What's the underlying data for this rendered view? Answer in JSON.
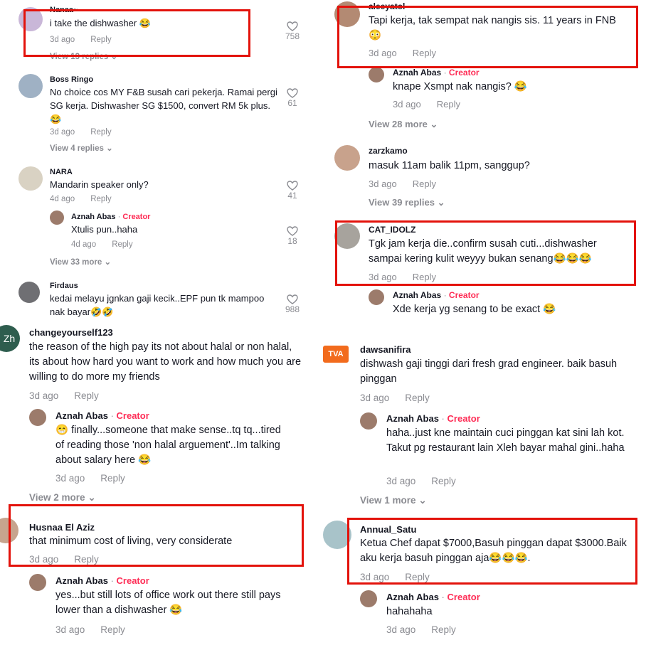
{
  "colors": {
    "accent": "#fe2c55",
    "muted": "#8a8b91",
    "highlight": "#e3120b",
    "text": "#161823"
  },
  "icons": {
    "like": "heart-outline-icon",
    "chevron": "chevron-down-icon"
  },
  "tl": {
    "c1": {
      "user": "Nanaa~",
      "text": "i take the dishwasher 😂",
      "time": "3d ago",
      "reply": "Reply",
      "likes": "758",
      "view": "View 13 replies"
    },
    "c2": {
      "user": "Boss Ringo",
      "text": "No choice cos MY F&B susah cari pekerja. Ramai pergi SG kerja. Dishwasher SG $1500, convert RM 5k plus. 😂",
      "time": "3d ago",
      "reply": "Reply",
      "likes": "61",
      "view": "View 4 replies"
    },
    "c3": {
      "user": "NARA",
      "text": "Mandarin speaker only?",
      "time": "4d ago",
      "reply": "Reply",
      "likes": "41"
    },
    "r3": {
      "user": "Aznah Abas",
      "creator": "Creator",
      "text": "Xtulis pun..haha",
      "time": "4d ago",
      "reply": "Reply",
      "likes": "18",
      "view": "View 33 more"
    },
    "c4": {
      "user": "Firdaus",
      "text": "kedai melayu jgnkan gaji kecik..EPF pun tk mampoo nak bayar🤣🤣",
      "likes": "988"
    }
  },
  "tr": {
    "c1": {
      "user": "aleeyatol",
      "text": "Tapi kerja, tak sempat nak nangis sis. 11 years in FNB 😳",
      "time": "3d ago",
      "reply": "Reply"
    },
    "r1": {
      "user": "Aznah Abas",
      "creator": "Creator",
      "text": "knape Xsmpt nak nangis? 😂",
      "time": "3d ago",
      "reply": "Reply",
      "view": "View 28 more"
    },
    "c2": {
      "user": "zarzkamo",
      "text": "masuk 11am balik 11pm, sanggup?",
      "time": "3d ago",
      "reply": "Reply",
      "view": "View 39 replies"
    },
    "c3": {
      "user": "CAT_IDOLZ",
      "text": "Tgk jam kerja die..confirm susah cuti...dishwasher sampai kering kulit weyyy bukan senang😂😂😂",
      "time": "3d ago",
      "reply": "Reply"
    },
    "r3": {
      "user": "Aznah Abas",
      "creator": "Creator",
      "text": "Xde kerja yg senang to be exact 😂"
    }
  },
  "bl": {
    "c1": {
      "user": "changeyourself123",
      "avatar_text": "Zh",
      "text": "the reason of the high pay its not about halal or non halal, its about how hard you want to work and how much you are willing to do more my friends",
      "time": "3d ago",
      "reply": "Reply"
    },
    "r1": {
      "user": "Aznah Abas",
      "creator": "Creator",
      "text": "😁 finally...someone that make sense..tq tq...tired of reading those 'non halal arguement'..Im talking about salary here 😂",
      "time": "3d ago",
      "reply": "Reply",
      "view": "View 2 more"
    },
    "c2": {
      "user": "Husnaa El Aziz",
      "text": "that minimum cost of living, very considerate",
      "time": "3d ago",
      "reply": "Reply"
    },
    "r2": {
      "user": "Aznah Abas",
      "creator": "Creator",
      "text": "yes...but still lots of office work out there still pays lower than a dishwasher 😂",
      "time": "3d ago",
      "reply": "Reply"
    }
  },
  "br": {
    "c1": {
      "user": "dawsanifira",
      "avatar_text": "TVA",
      "text": "dishwash gaji tinggi dari fresh grad engineer. baik basuh pinggan",
      "time": "3d ago",
      "reply": "Reply"
    },
    "r1": {
      "user": "Aznah Abas",
      "creator": "Creator",
      "text": "haha..just kne maintain cuci pinggan kat sini lah kot. Takut pg restaurant lain Xleh bayar mahal gini..haha",
      "time": "3d ago",
      "reply": "Reply",
      "view": "View 1 more"
    },
    "c2": {
      "user": "Annual_Satu",
      "text": "Ketua Chef dapat $7000,Basuh pinggan dapat $3000.Baik aku kerja basuh pinggan aja😂😂😂.",
      "time": "3d ago",
      "reply": "Reply"
    },
    "r2": {
      "user": "Aznah Abas",
      "creator": "Creator",
      "text": "hahahaha",
      "time": "3d ago",
      "reply": "Reply"
    }
  }
}
